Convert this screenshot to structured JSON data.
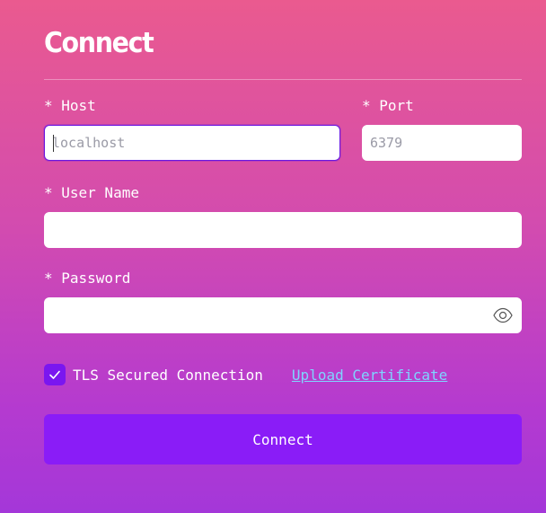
{
  "form": {
    "title": "Connect",
    "host": {
      "label": "* Host",
      "value": "",
      "placeholder": "localhost"
    },
    "port": {
      "label": "* Port",
      "value": "",
      "placeholder": "6379"
    },
    "username": {
      "label": "* User Name",
      "value": "",
      "placeholder": ""
    },
    "password": {
      "label": "* Password",
      "value": "",
      "placeholder": "",
      "toggle_icon": "eye-icon"
    },
    "tls": {
      "checked": true,
      "label": "TLS Secured Connection",
      "upload_link": "Upload Certificate"
    },
    "submit_label": "Connect"
  },
  "colors": {
    "gradient_top": "#ea5a8f",
    "gradient_bottom": "#a437d9",
    "accent": "#8a1cf7",
    "link": "#7fd4ff"
  }
}
